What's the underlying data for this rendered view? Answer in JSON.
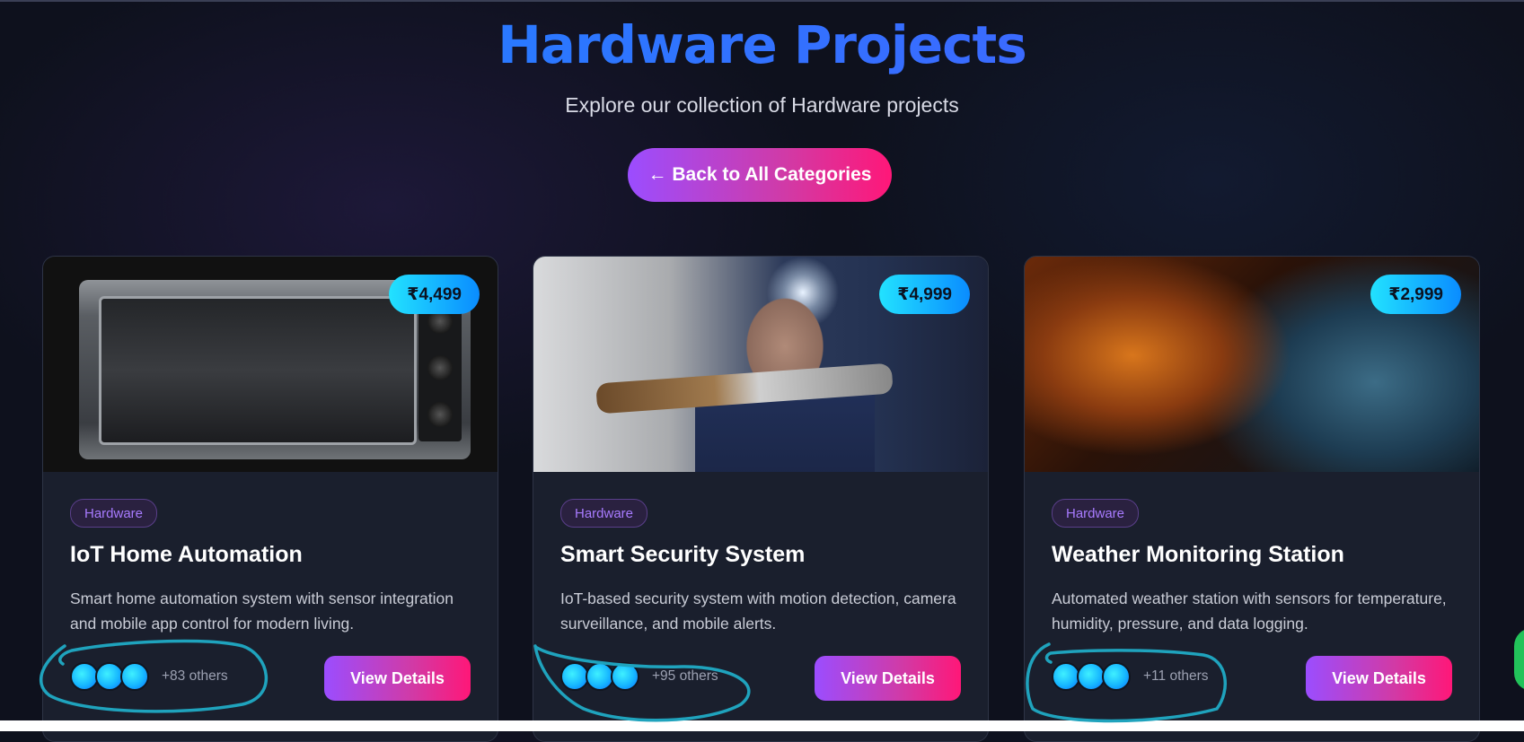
{
  "header": {
    "title": "Hardware Projects",
    "subtitle": "Explore our collection of Hardware projects",
    "back_label": "← Back to All Categories"
  },
  "cards": [
    {
      "price": "₹4,499",
      "tag": "Hardware",
      "title": "IoT Home Automation",
      "description": "Smart home automation system with sensor integration and mobile app control for modern living.",
      "others": "+83 others",
      "button": "View Details",
      "image": "toaster-oven-photo"
    },
    {
      "price": "₹4,999",
      "tag": "Hardware",
      "title": "Smart Security System",
      "description": "IoT-based security system with motion detection, camera surveillance, and mobile alerts.",
      "others": "+95 others",
      "button": "View Details",
      "image": "soldering-man-photo"
    },
    {
      "price": "₹2,999",
      "tag": "Hardware",
      "title": "Weather Monitoring Station",
      "description": "Automated weather station with sensors for temperature, humidity, pressure, and data logging.",
      "others": "+11 others",
      "button": "View Details",
      "image": "storm-clouds-photo"
    }
  ],
  "colors": {
    "background": "#0e111d",
    "card": "#1a1f2d",
    "accent_gradient_start": "#9b4dff",
    "accent_gradient_end": "#ff1778",
    "price_gradient_start": "#22e2ff",
    "price_gradient_end": "#0a8cff",
    "title_blue": "#1a86ff",
    "annotation": "#1fa3bd"
  }
}
